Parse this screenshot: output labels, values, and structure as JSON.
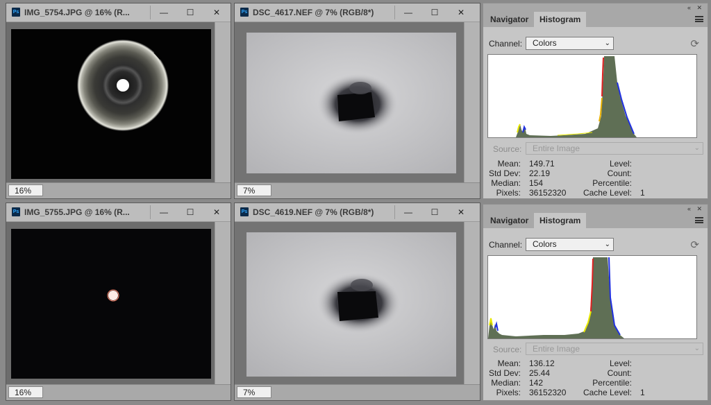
{
  "documents": [
    {
      "title": "IMG_5754.JPG @ 16% (R...",
      "zoom": "16%",
      "image": "ring"
    },
    {
      "title": "DSC_4617.NEF @ 7% (RGB/8*)",
      "zoom": "7%",
      "image": "hole"
    },
    {
      "title": "IMG_5755.JPG @ 16% (R...",
      "zoom": "16%",
      "image": "dot"
    },
    {
      "title": "DSC_4619.NEF @ 7% (RGB/8*)",
      "zoom": "7%",
      "image": "hole"
    }
  ],
  "window_buttons": {
    "minimize": "—",
    "maximize": "☐",
    "close": "✕"
  },
  "panels": [
    {
      "collapse": "«",
      "close": "✕",
      "tabs": {
        "navigator": "Navigator",
        "histogram": "Histogram"
      },
      "channel_label": "Channel:",
      "channel_value": "Colors",
      "source_label": "Source:",
      "source_value": "Entire Image",
      "stats_left": {
        "mean_label": "Mean:",
        "mean": "149.71",
        "std_label": "Std Dev:",
        "std": "22.19",
        "median_label": "Median:",
        "median": "154",
        "pixels_label": "Pixels:",
        "pixels": "36152320"
      },
      "stats_right": {
        "level_label": "Level:",
        "count_label": "Count:",
        "percentile_label": "Percentile:",
        "cache_label": "Cache Level:",
        "cache": "1"
      }
    },
    {
      "collapse": "«",
      "close": "✕",
      "tabs": {
        "navigator": "Navigator",
        "histogram": "Histogram"
      },
      "channel_label": "Channel:",
      "channel_value": "Colors",
      "source_label": "Source:",
      "source_value": "Entire Image",
      "stats_left": {
        "mean_label": "Mean:",
        "mean": "136.12",
        "std_label": "Std Dev:",
        "std": "25.44",
        "median_label": "Median:",
        "median": "142",
        "pixels_label": "Pixels:",
        "pixels": "36152320"
      },
      "stats_right": {
        "level_label": "Level:",
        "count_label": "Count:",
        "percentile_label": "Percentile:",
        "cache_label": "Cache Level:",
        "cache": "1"
      }
    }
  ],
  "colors": {
    "histogram_fill": "#5f6f55",
    "red_edge": "#e02020",
    "yellow_edge": "#e8e800",
    "blue_edge": "#2030e0",
    "accent": "#31a8ff"
  }
}
